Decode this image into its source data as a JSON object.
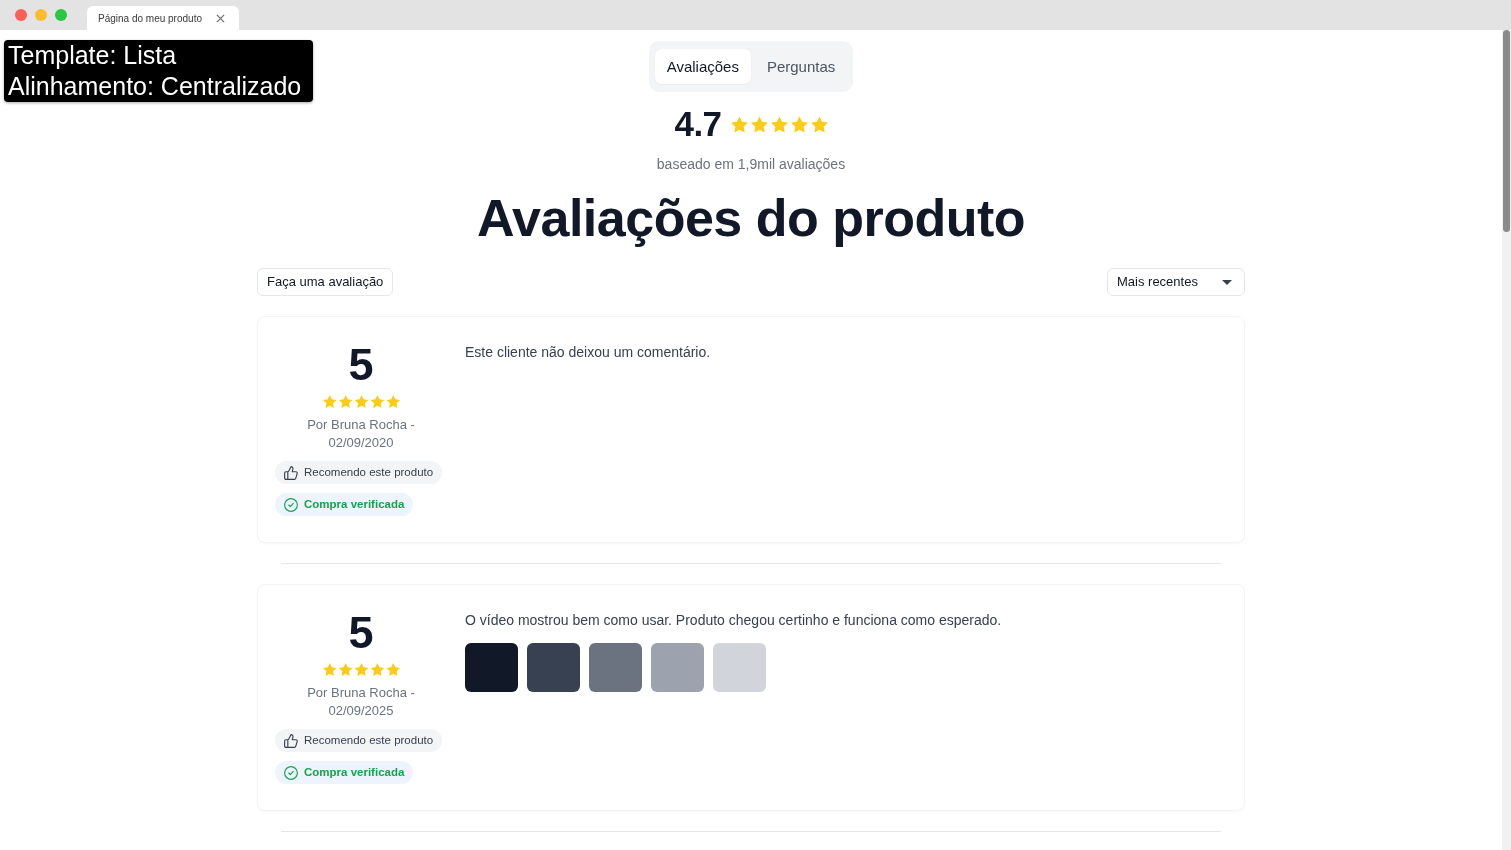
{
  "browser": {
    "tab_title": "Página do meu produto"
  },
  "overlay_label": {
    "lines": [
      "Template: Lista",
      "Alinhamento: Centralizado"
    ]
  },
  "tabs": [
    {
      "label": "Avaliações",
      "selected": true
    },
    {
      "label": "Perguntas",
      "selected": false
    }
  ],
  "summary": {
    "score": "4.7",
    "stars": 5,
    "based_on": "baseado em 1,9mil avaliações"
  },
  "heading": "Avaliações do produto",
  "toolbar": {
    "write_button": "Faça uma avaliação",
    "sort": {
      "value": "Mais recentes"
    }
  },
  "reviews": [
    {
      "score": "5",
      "stars": 5,
      "byline": "Por Bruna Rocha - 02/09/2020",
      "badges": [
        {
          "kind": "recommend",
          "label": "Recomendo este produto"
        },
        {
          "kind": "verified",
          "label": "Compra verificada"
        }
      ],
      "comment": "Este cliente não deixou um comentário."
    },
    {
      "score": "5",
      "stars": 5,
      "byline": "Por Bruna Rocha - 02/09/2025",
      "badges": [
        {
          "kind": "recommend",
          "label": "Recomendo este produto"
        },
        {
          "kind": "verified",
          "label": "Compra verificada"
        }
      ],
      "comment": "O vídeo mostrou bem como usar. Produto chegou certinho e funciona como esperado.",
      "media": [
        {
          "color": "#111827"
        },
        {
          "color": "#374151"
        },
        {
          "color": "#6b7280"
        },
        {
          "color": "#9ca3af"
        },
        {
          "color": "#d1d5db"
        }
      ]
    }
  ]
}
